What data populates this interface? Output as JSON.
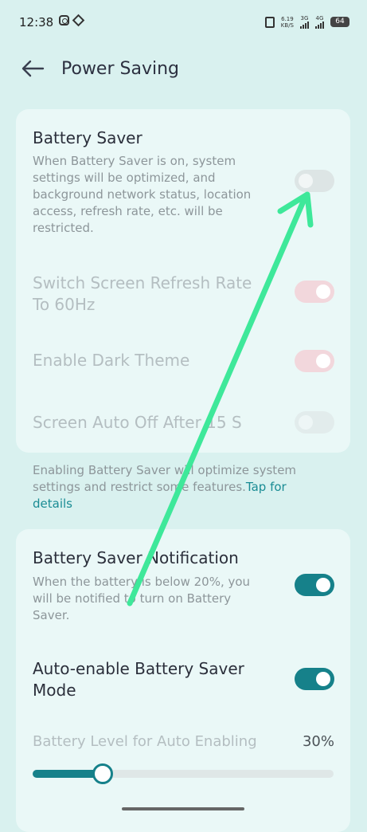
{
  "status_bar": {
    "time": "12:38",
    "speed_top": "6.19",
    "speed_bottom": "KB/S",
    "net1": "3G",
    "net2": "4G",
    "battery": "64"
  },
  "header": {
    "title": "Power Saving"
  },
  "battery_saver": {
    "title": "Battery Saver",
    "description": "When Battery Saver is on, system settings will be optimized, and background network status, location access, refresh rate, etc. will be restricted.",
    "enabled": false
  },
  "refresh_rate": {
    "title": "Switch Screen Refresh Rate To 60Hz",
    "enabled": true,
    "disabled": true
  },
  "dark_theme": {
    "title": "Enable Dark Theme",
    "enabled": true,
    "disabled": true
  },
  "screen_off": {
    "title": "Screen Auto Off After 15 S",
    "enabled": false,
    "disabled": true
  },
  "info": {
    "text": "Enabling Battery Saver will optimize system settings and restrict some features.",
    "link": "Tap for details"
  },
  "notification": {
    "title": "Battery Saver Notification",
    "description": "When the battery is below 20%, you will be notified to turn on Battery Saver.",
    "enabled": true
  },
  "auto_enable": {
    "title": "Auto-enable Battery Saver Mode",
    "enabled": true
  },
  "battery_level": {
    "label": "Battery Level for Auto Enabling",
    "value": "30%",
    "fraction": 0.2
  },
  "colors": {
    "accent": "#16818a",
    "annotation_arrow": "#3ee89a"
  }
}
